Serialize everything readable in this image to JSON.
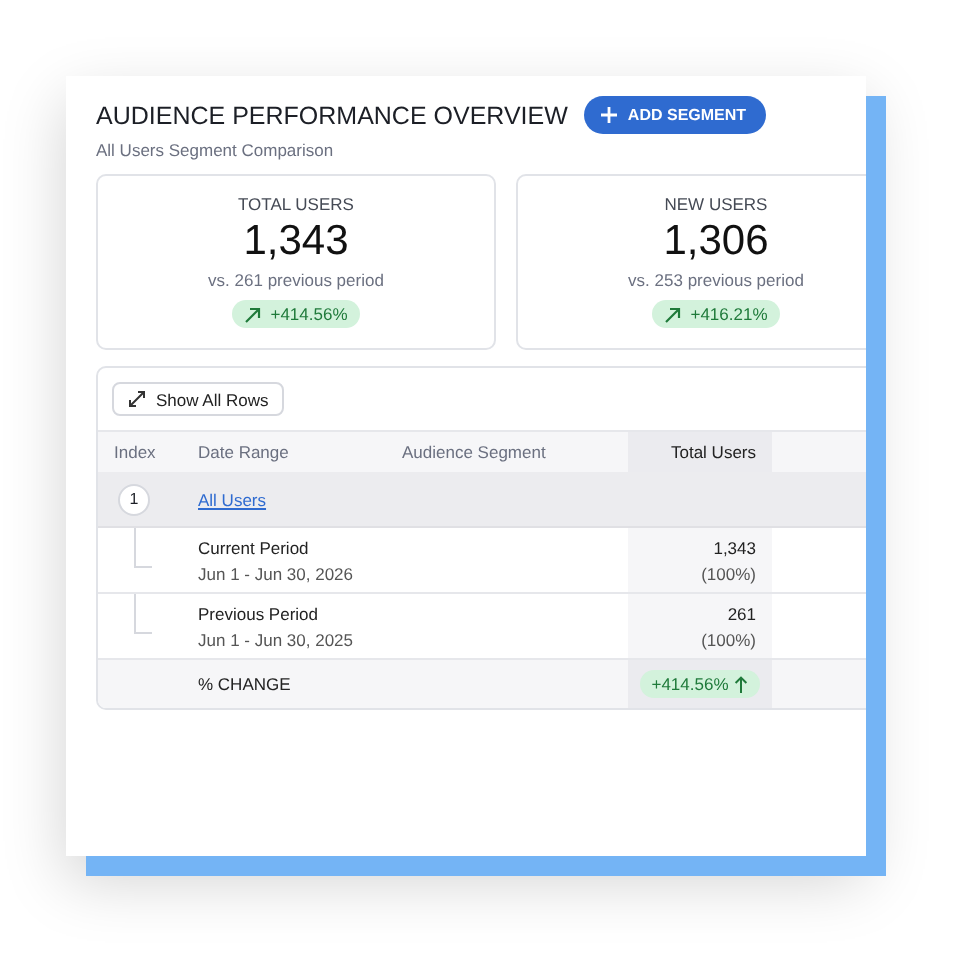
{
  "header": {
    "title": "AUDIENCE PERFORMANCE OVERVIEW",
    "add_button": "ADD SEGMENT",
    "subtitle": "All Users Segment Comparison"
  },
  "stats": [
    {
      "label": "TOTAL USERS",
      "value": "1,343",
      "comparison": "vs. 261 previous period",
      "change": "+414.56%"
    },
    {
      "label": "NEW USERS",
      "value": "1,306",
      "comparison": "vs. 253 previous period",
      "change": "+416.21%"
    }
  ],
  "table": {
    "toolbar_button": "Show All Rows",
    "columns": [
      {
        "label": "Index",
        "highlighted": false
      },
      {
        "label": "Date Range",
        "highlighted": false
      },
      {
        "label": "Audience Segment",
        "highlighted": false
      },
      {
        "label": "Total Users",
        "highlighted": true
      }
    ],
    "group": {
      "index": "1",
      "name": "All Users"
    },
    "rows": [
      {
        "label": "Current Period",
        "range": "Jun 1 - Jun 30, 2026",
        "value": "1,343",
        "share": "(100%)"
      },
      {
        "label": "Previous Period",
        "range": "Jun 1 - Jun 30, 2025",
        "value": "261",
        "share": "(100%)"
      }
    ],
    "change_row": {
      "label": "% CHANGE",
      "value": "+414.56%"
    }
  }
}
